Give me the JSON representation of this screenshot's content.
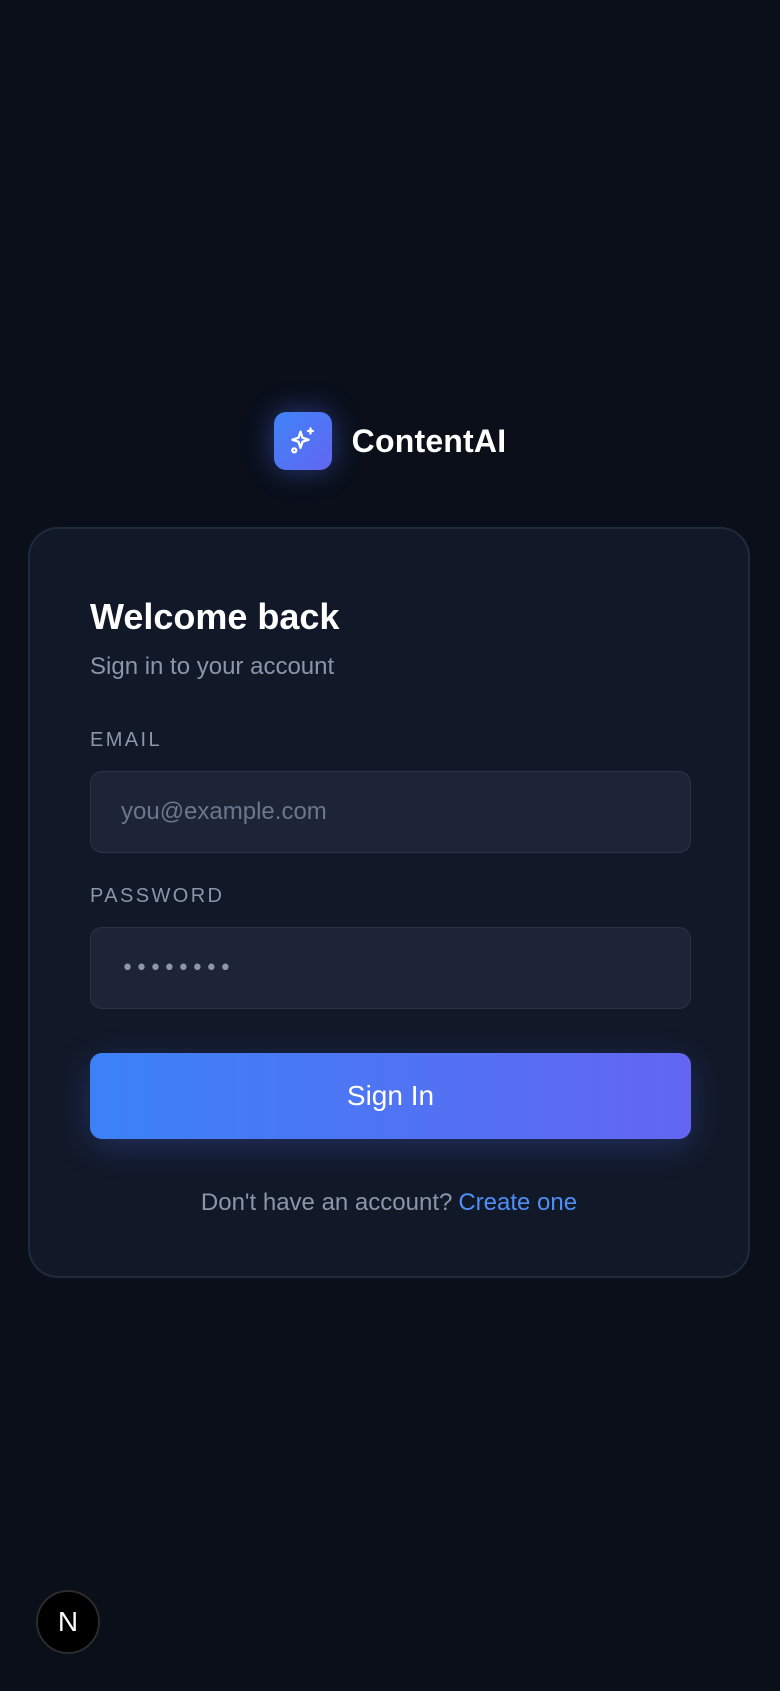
{
  "brand": {
    "name": "ContentAI",
    "icon": "sparkles-icon"
  },
  "login": {
    "title": "Welcome back",
    "subtitle": "Sign in to your account",
    "email": {
      "label": "EMAIL",
      "placeholder": "you@example.com",
      "value": ""
    },
    "password": {
      "label": "PASSWORD",
      "masked_value": "••••••••"
    },
    "submit_label": "Sign In",
    "signup_prompt": "Don't have an account?",
    "signup_link": "Create one"
  },
  "dev_badge": {
    "letter": "N",
    "icon": "nextjs-icon"
  },
  "colors": {
    "background": "#0a0f1a",
    "card": "#111827",
    "accent_start": "#3b82f6",
    "accent_end": "#6366f1",
    "link": "#4f8ef7",
    "muted_text": "#8b96ab"
  }
}
